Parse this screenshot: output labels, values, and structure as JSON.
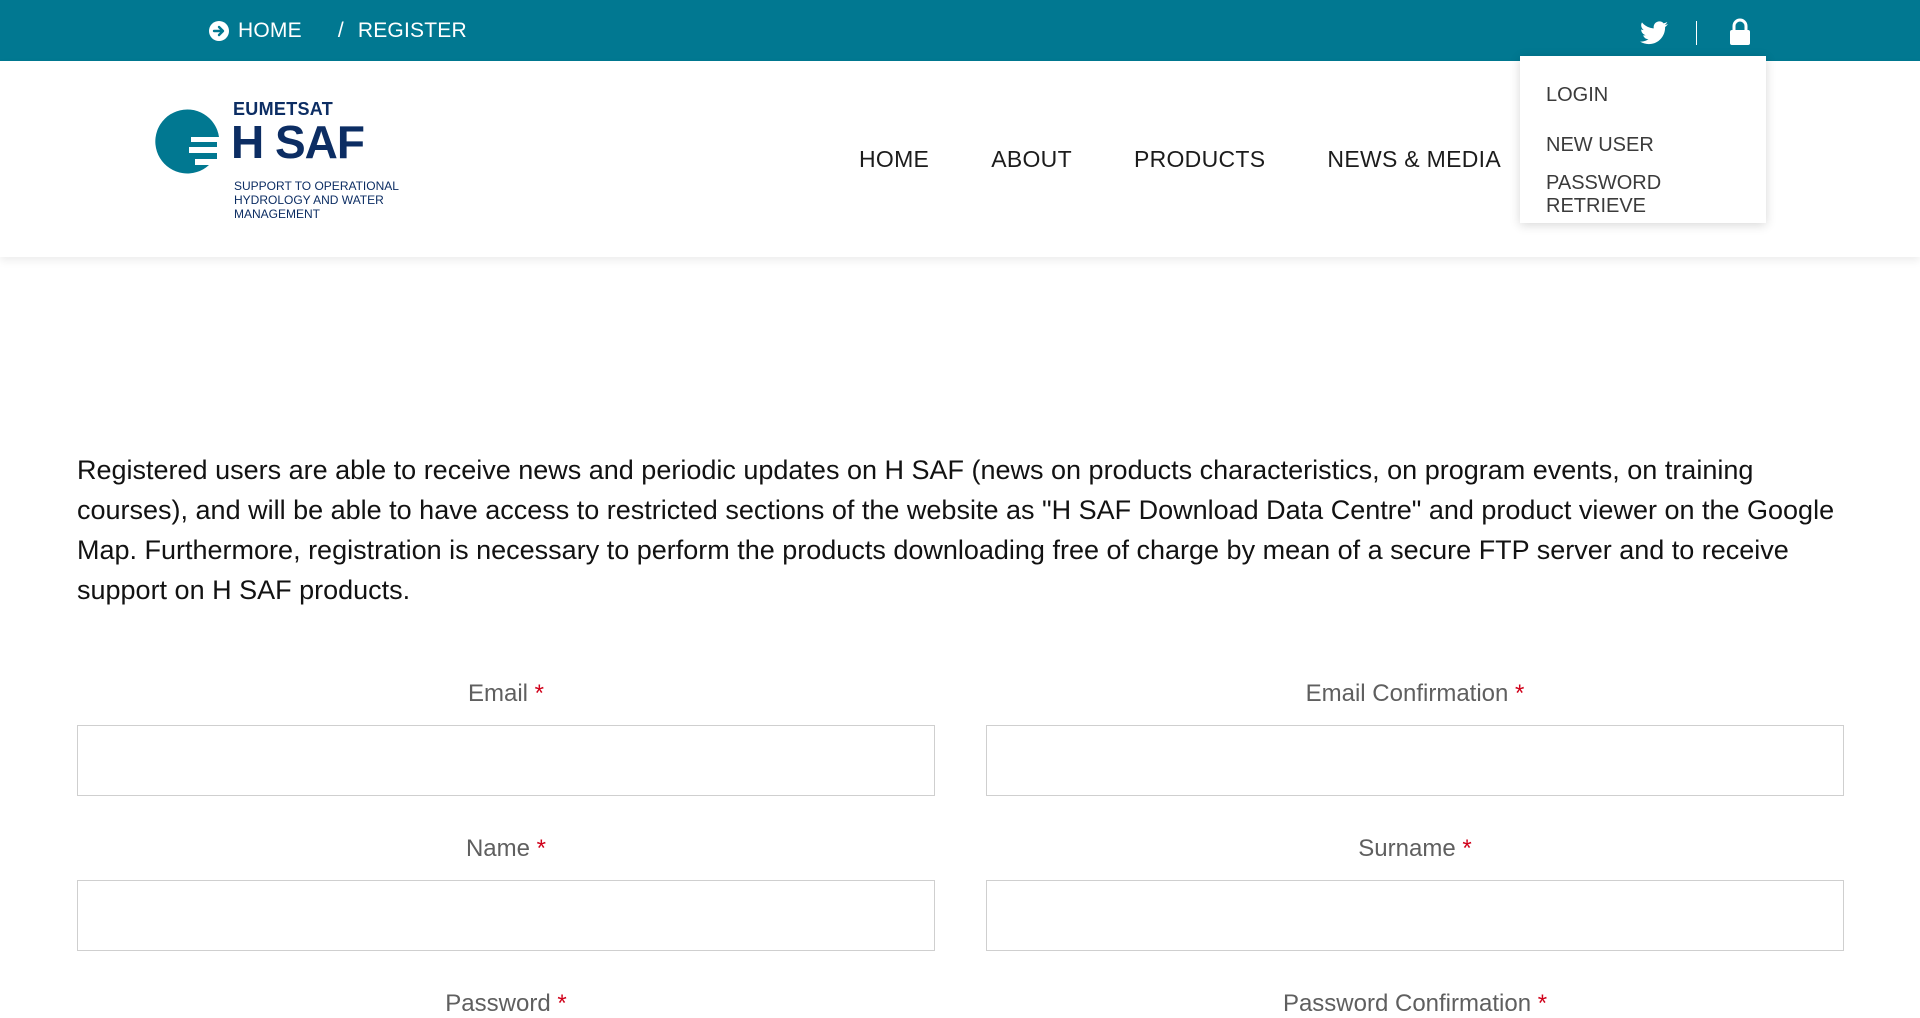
{
  "breadcrumb": {
    "home": "HOME",
    "separator": "/",
    "current": "REGISTER"
  },
  "top_icons": [
    "arrow-circle-right-icon",
    "twitter-icon",
    "lock-icon"
  ],
  "logo": {
    "brand": "EUMETSAT",
    "name": "H SAF",
    "tagline": "SUPPORT TO OPERATIONAL HYDROLOGY AND WATER MANAGEMENT"
  },
  "nav": {
    "items": [
      "HOME",
      "ABOUT",
      "PRODUCTS",
      "NEWS & MEDIA"
    ]
  },
  "user_menu": {
    "items": [
      "LOGIN",
      "NEW USER",
      "PASSWORD RETRIEVE"
    ]
  },
  "intro": "Registered users are able to receive news and periodic updates on H SAF (news on products characteristics, on program events, on training courses), and will be able to have access to restricted sections of the website as \"H SAF Download Data Centre\" and product viewer on the Google Map. Furthermore, registration is necessary to perform the products downloading free of charge by mean of a secure FTP server and to receive support on H SAF products.",
  "form": {
    "required_mark": "*",
    "email": {
      "label": "Email",
      "value": ""
    },
    "email_confirmation": {
      "label": "Email Confirmation",
      "value": ""
    },
    "name": {
      "label": "Name",
      "value": ""
    },
    "surname": {
      "label": "Surname",
      "value": ""
    },
    "password": {
      "label": "Password"
    },
    "password_confirmation": {
      "label": "Password Confirmation"
    }
  },
  "colors": {
    "topbar": "#017891",
    "brand_navy": "#0c2d63",
    "brand_teal": "#017891",
    "required": "#d0021b"
  }
}
